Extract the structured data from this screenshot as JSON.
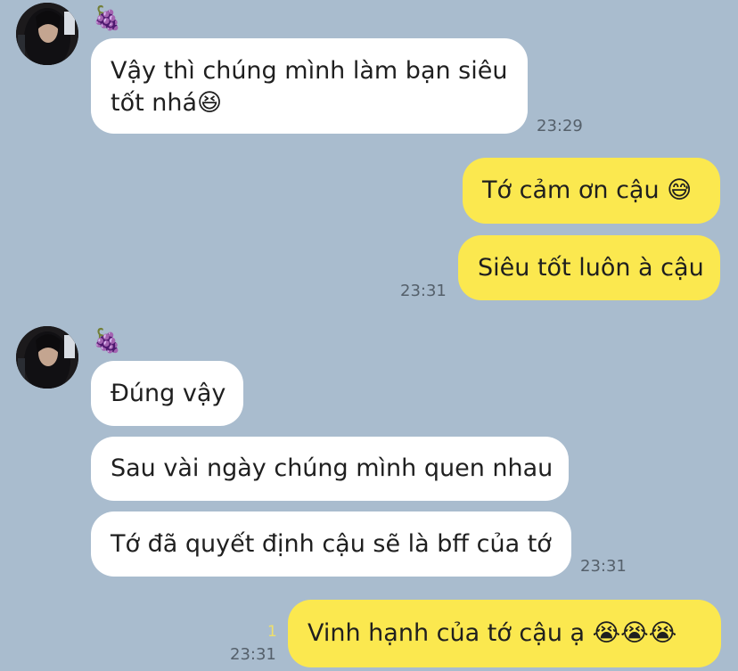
{
  "contact": {
    "name_emoji": "🍇"
  },
  "messages": [
    {
      "side": "in",
      "text_line1": "Vậy thì chúng mình làm bạn siêu",
      "text_line2": "tốt nhá😆",
      "time": "23:29"
    },
    {
      "side": "out",
      "text": "Tớ cảm ơn cậu 😅"
    },
    {
      "side": "out",
      "text": "Siêu tốt luôn à cậu",
      "time": "23:31"
    },
    {
      "side": "in",
      "text": "Đúng vậy"
    },
    {
      "side": "in",
      "text": "Sau vài ngày chúng mình quen nhau"
    },
    {
      "side": "in",
      "text": "Tớ đã quyết định cậu sẽ là bff của tớ",
      "time": "23:31"
    },
    {
      "side": "out",
      "text": "Vinh hạnh của tớ cậu ạ 😭😭😭",
      "time": "23:31",
      "read_count": "1"
    }
  ],
  "colors": {
    "background": "#a9bcce",
    "incoming_bubble": "#ffffff",
    "outgoing_bubble": "#fbe84f",
    "read_count": "#efe06a"
  }
}
